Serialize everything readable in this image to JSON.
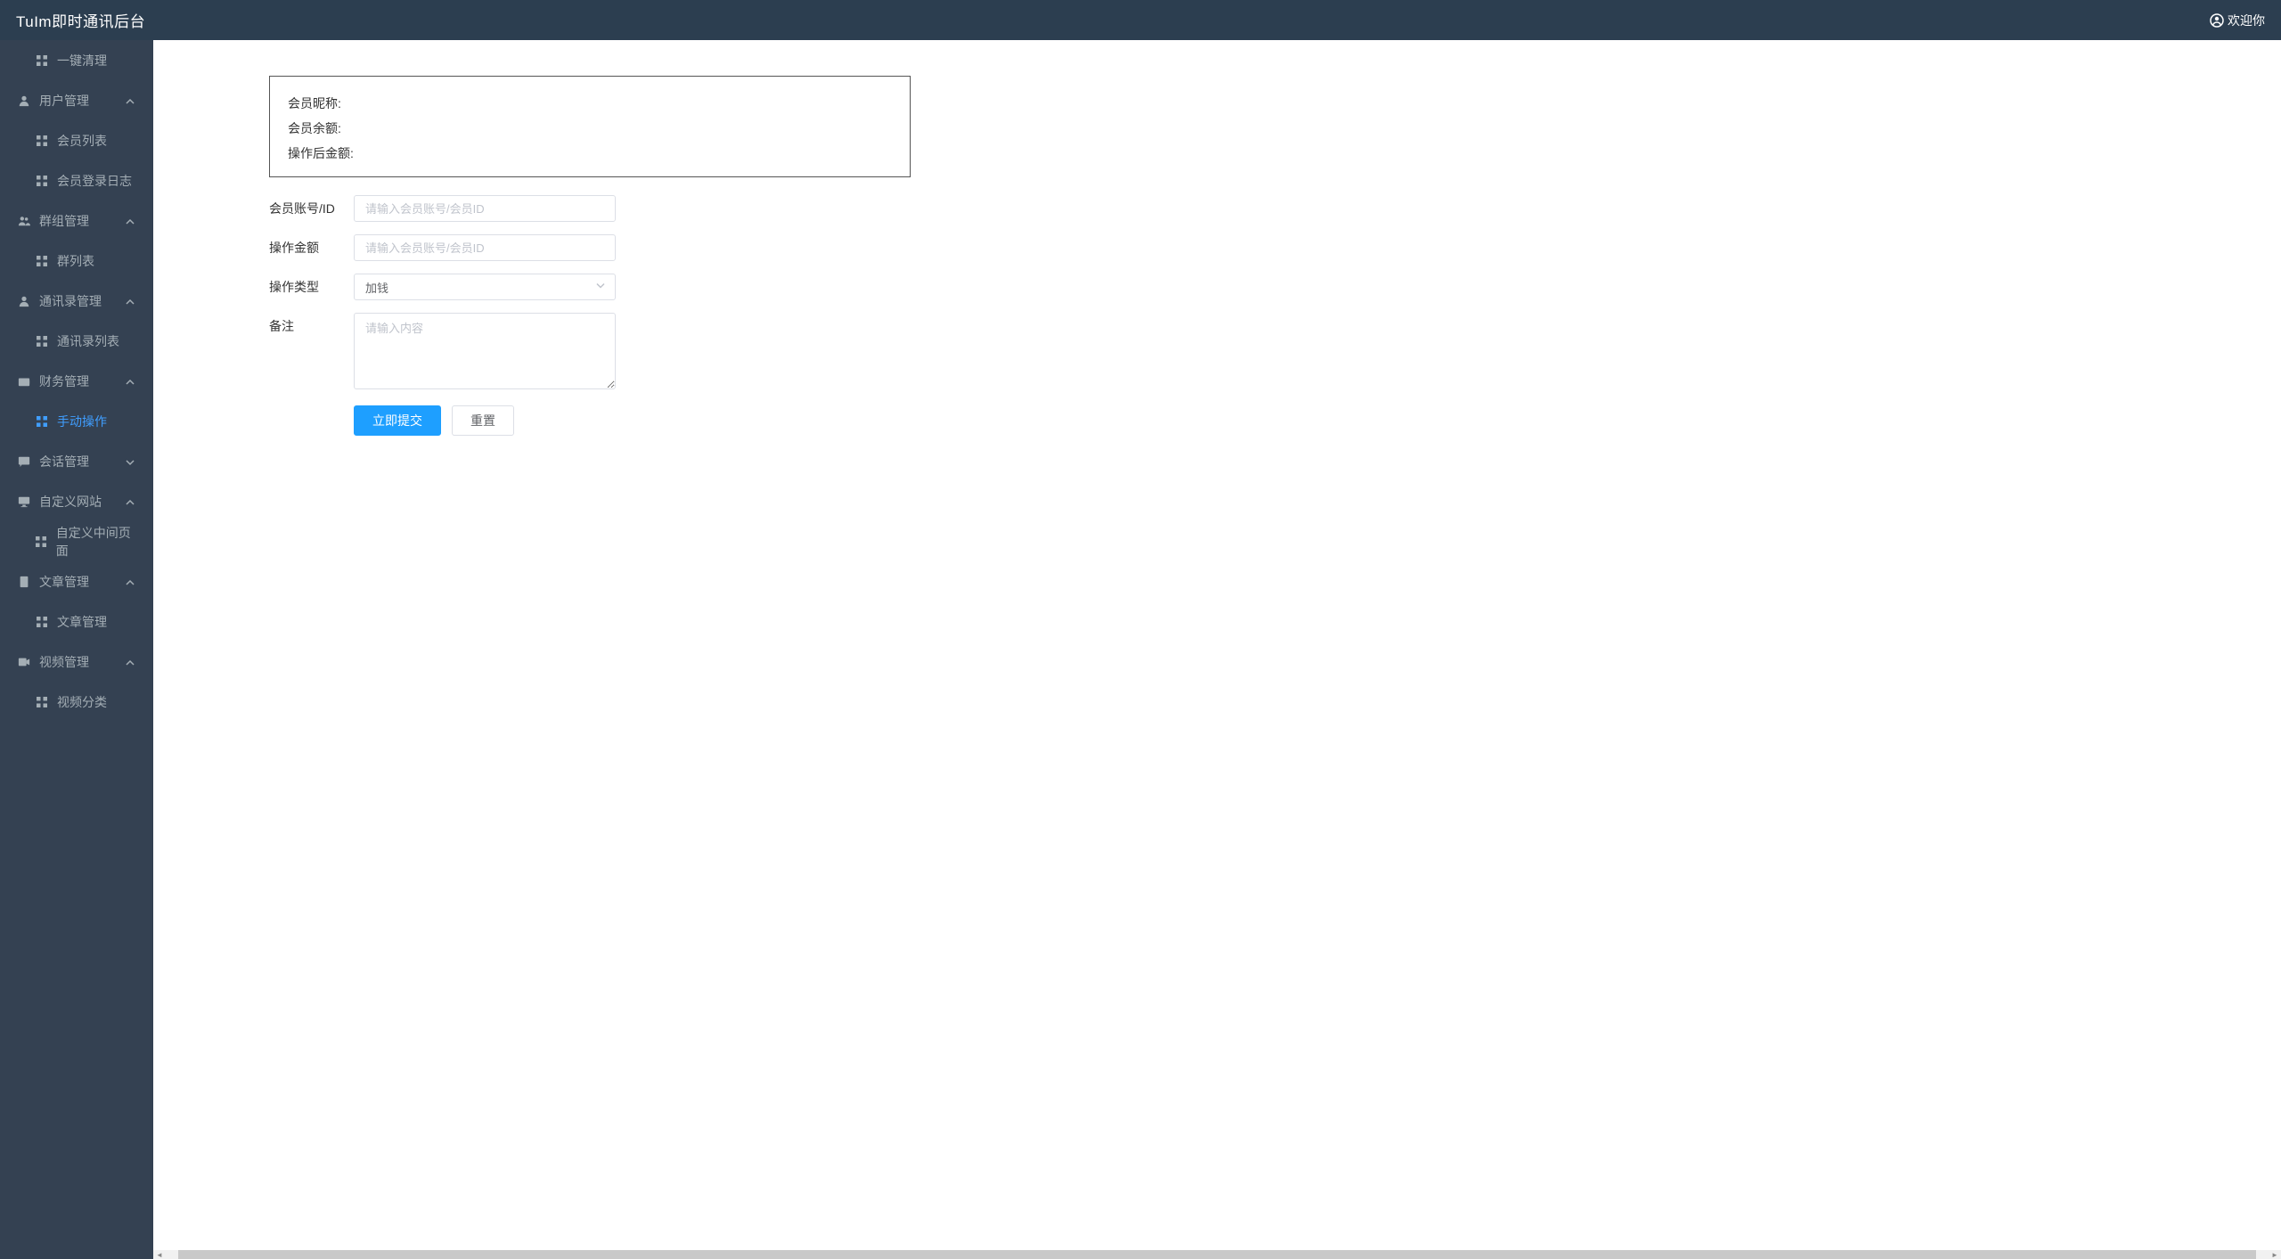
{
  "header": {
    "title": "TuIm即时通讯后台",
    "welcome": "欢迎你"
  },
  "sidebar": [
    {
      "type": "item",
      "icon": "grid",
      "label": "一键清理",
      "level": 2
    },
    {
      "type": "item",
      "icon": "user",
      "label": "用户管理",
      "level": 1,
      "expand": "up"
    },
    {
      "type": "item",
      "icon": "grid",
      "label": "会员列表",
      "level": 2
    },
    {
      "type": "item",
      "icon": "grid",
      "label": "会员登录日志",
      "level": 2
    },
    {
      "type": "item",
      "icon": "users",
      "label": "群组管理",
      "level": 1,
      "expand": "up"
    },
    {
      "type": "item",
      "icon": "grid",
      "label": "群列表",
      "level": 2
    },
    {
      "type": "item",
      "icon": "user",
      "label": "通讯录管理",
      "level": 1,
      "expand": "up"
    },
    {
      "type": "item",
      "icon": "grid",
      "label": "通讯录列表",
      "level": 2
    },
    {
      "type": "item",
      "icon": "wallet",
      "label": "财务管理",
      "level": 1,
      "expand": "up"
    },
    {
      "type": "item",
      "icon": "grid",
      "label": "手动操作",
      "level": 2,
      "active": true
    },
    {
      "type": "item",
      "icon": "chat",
      "label": "会话管理",
      "level": 1,
      "expand": "down"
    },
    {
      "type": "item",
      "icon": "monitor",
      "label": "自定义网站",
      "level": 1,
      "expand": "up"
    },
    {
      "type": "item",
      "icon": "grid",
      "label": "自定义中间页面",
      "level": 2
    },
    {
      "type": "item",
      "icon": "doc",
      "label": "文章管理",
      "level": 1,
      "expand": "up"
    },
    {
      "type": "item",
      "icon": "grid",
      "label": "文章管理",
      "level": 2
    },
    {
      "type": "item",
      "icon": "video",
      "label": "视频管理",
      "level": 1,
      "expand": "up"
    },
    {
      "type": "item",
      "icon": "grid",
      "label": "视频分类",
      "level": 2
    }
  ],
  "info": {
    "nickLabel": "会员昵称",
    "balanceLabel": "会员余额",
    "afterLabel": "操作后金额"
  },
  "form": {
    "accountLabel": "会员账号/ID",
    "accountPlaceholder": "请输入会员账号/会员ID",
    "amountLabel": "操作金额",
    "amountPlaceholder": "请输入会员账号/会员ID",
    "typeLabel": "操作类型",
    "typeValue": "加钱",
    "remarkLabel": "备注",
    "remarkPlaceholder": "请输入内容",
    "submitLabel": "立即提交",
    "resetLabel": "重置"
  }
}
